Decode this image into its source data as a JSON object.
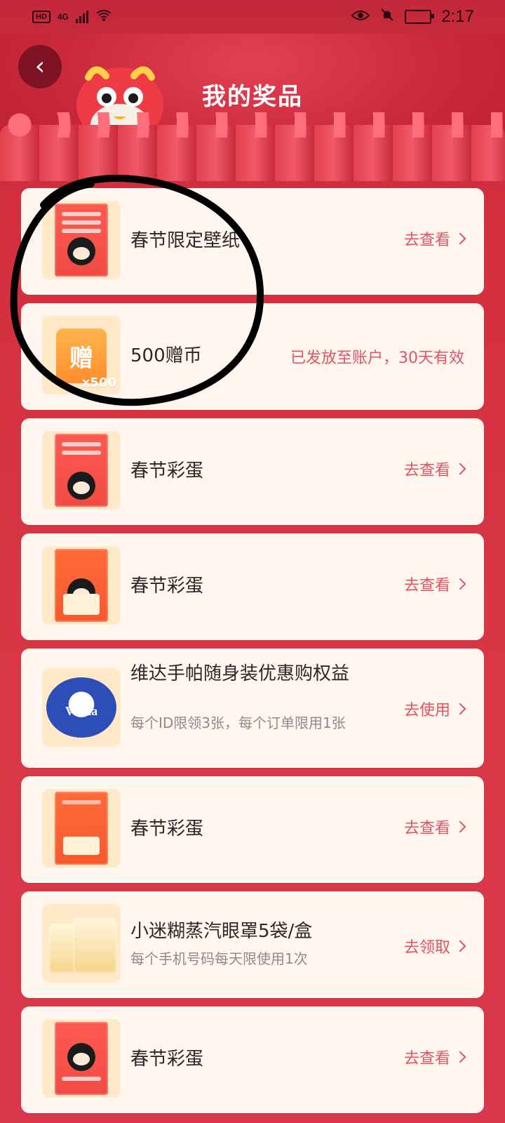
{
  "status_bar": {
    "hd": "HD",
    "network": "4G",
    "time": "2:17"
  },
  "header": {
    "title": "我的奖品"
  },
  "items": [
    {
      "name": "春节限定壁纸",
      "action": "去查看",
      "kind": "poster"
    },
    {
      "name": "500赠币",
      "status": "已发放至账户，30天有效",
      "kind": "gift",
      "badge": "赠",
      "count": "x500"
    },
    {
      "name": "春节彩蛋",
      "action": "去查看",
      "kind": "poster"
    },
    {
      "name": "春节彩蛋",
      "action": "去查看",
      "kind": "poster"
    },
    {
      "name": "维达手帕随身装优惠购权益",
      "sub": "每个ID限领3张，每个订单限用1张",
      "action": "去使用",
      "kind": "vinda"
    },
    {
      "name": "春节彩蛋",
      "action": "去查看",
      "kind": "poster"
    },
    {
      "name": "小迷糊蒸汽眼罩5袋/盒",
      "sub": "每个手机号码每天限使用1次",
      "action": "去领取",
      "kind": "box"
    },
    {
      "name": "春节彩蛋",
      "action": "去查看",
      "kind": "poster"
    }
  ],
  "colors": {
    "background": "#d32f3f",
    "card": "#fff6ef",
    "accent": "#e25462"
  },
  "icons": {
    "back": "chevron-left-icon",
    "eye": "eye-icon",
    "mute": "bell-off-icon",
    "battery": "battery-charging-icon",
    "wifi": "wifi-icon",
    "signal": "signal-icon"
  }
}
